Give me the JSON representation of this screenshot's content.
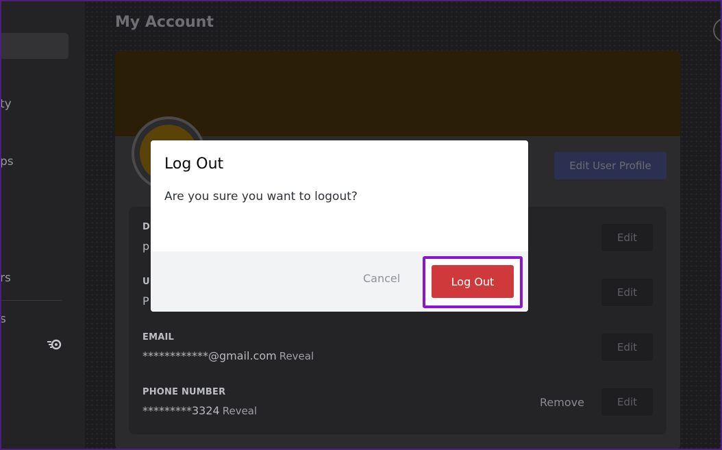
{
  "page": {
    "title": "My Account"
  },
  "sidebar": {
    "fragments": [
      "ty",
      "ps",
      "rs",
      "s"
    ]
  },
  "profile": {
    "edit_profile_label": "Edit User Profile"
  },
  "fields": [
    {
      "label": "D",
      "value": "p",
      "edit": "Edit"
    },
    {
      "label": "U",
      "value": "P",
      "edit": "Edit"
    },
    {
      "label": "EMAIL",
      "value": "************@gmail.com",
      "reveal": "Reveal",
      "edit": "Edit"
    },
    {
      "label": "PHONE NUMBER",
      "value": "*********3324",
      "reveal": "Reveal",
      "remove": "Remove",
      "edit": "Edit"
    }
  ],
  "modal": {
    "title": "Log Out",
    "body": "Are you sure you want to logout?",
    "cancel_label": "Cancel",
    "confirm_label": "Log Out"
  },
  "colors": {
    "confirm": "#d0393b",
    "highlight": "#8a16cf",
    "banner": "#2a1e06"
  }
}
